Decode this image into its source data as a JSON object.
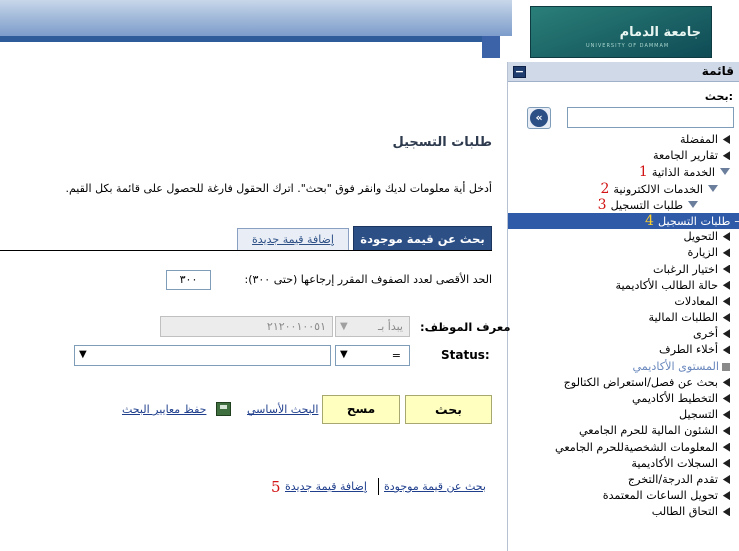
{
  "header": {
    "logo_text": "جامعة الدمام",
    "logo_sub": "UNIVERSITY OF DAMMAM"
  },
  "sidebar": {
    "title": "قائمة",
    "collapse_label": "−",
    "search_label": "بحث:",
    "search_value": "",
    "go_label": "«",
    "items": [
      {
        "label": "المفضلة",
        "icon": "arrow"
      },
      {
        "label": "تقارير الجامعة",
        "icon": "arrow"
      },
      {
        "label": "الخدمة الذاتية",
        "icon": "down",
        "marker": "1"
      },
      {
        "label": "الخدمات الالكترونية",
        "icon": "down",
        "marker": "2"
      },
      {
        "label": "طلبات التسجيل",
        "icon": "down",
        "marker": "3"
      },
      {
        "label": "طلبات التسجيل",
        "icon": "dash",
        "marker": "4",
        "selected": true
      },
      {
        "label": "التحويل",
        "icon": "arrow"
      },
      {
        "label": "الزيارة",
        "icon": "arrow"
      },
      {
        "label": "اختيار الرغبات",
        "icon": "arrow"
      },
      {
        "label": "حالة الطالب الأكاديمية",
        "icon": "arrow"
      },
      {
        "label": "المعادلات",
        "icon": "arrow"
      },
      {
        "label": "الطلبات المالية",
        "icon": "arrow"
      },
      {
        "label": "أخرى",
        "icon": "arrow"
      },
      {
        "label": "أخلاء الطرف",
        "icon": "arrow"
      },
      {
        "label": "المستوى الأكاديمي",
        "icon": "square",
        "grey": true
      },
      {
        "label": "بحث عن فصل/استعراض الكتالوج",
        "icon": "arrow"
      },
      {
        "label": "التخطيط الأكاديمي",
        "icon": "arrow"
      },
      {
        "label": "التسجيل",
        "icon": "arrow"
      },
      {
        "label": "الشئون المالية للحرم الجامعي",
        "icon": "arrow"
      },
      {
        "label": "المعلومات الشخصيةللحرم الجامعي",
        "icon": "arrow"
      },
      {
        "label": "السجلات الأكاديمية",
        "icon": "arrow"
      },
      {
        "label": "تقدم الدرجة/التخرج",
        "icon": "arrow"
      },
      {
        "label": "تحويل الساعات المعتمدة",
        "icon": "arrow"
      },
      {
        "label": "التحاق الطالب",
        "icon": "arrow"
      }
    ]
  },
  "main": {
    "page_title": "طلبات التسجيل",
    "instructions": "أدخل أية معلومات لديك وانقر فوق \"بحث\". اترك الحقول فارغة للحصول على قائمة بكل القيم.",
    "tabs": [
      {
        "label": "بحث عن قيمة موجودة",
        "active": true
      },
      {
        "label": "إضافة قيمة جديدة",
        "active": false
      }
    ],
    "max_rows_label": "الحد الأقصى لعدد الصفوف المقرر إرجاعها (حتى ٣٠٠):",
    "max_rows_value": "٣٠٠",
    "employee_id_label": "معرف الموظف:",
    "employee_id_operator": "يبدأ بـ",
    "employee_id_value": "٢١٢٠٠١٠٠٥١",
    "status_label": "Status:",
    "status_operator": "=",
    "status_value": "",
    "search_button": "بحث",
    "clear_button": "مسح",
    "basic_search_link": "البحث الأساسي",
    "save_criteria_link": "حفظ معايير البحث",
    "bottom_links": {
      "find_existing": "بحث عن قيمة موجودة",
      "add_new": "إضافة قيمة جديدة",
      "marker": "5"
    }
  }
}
